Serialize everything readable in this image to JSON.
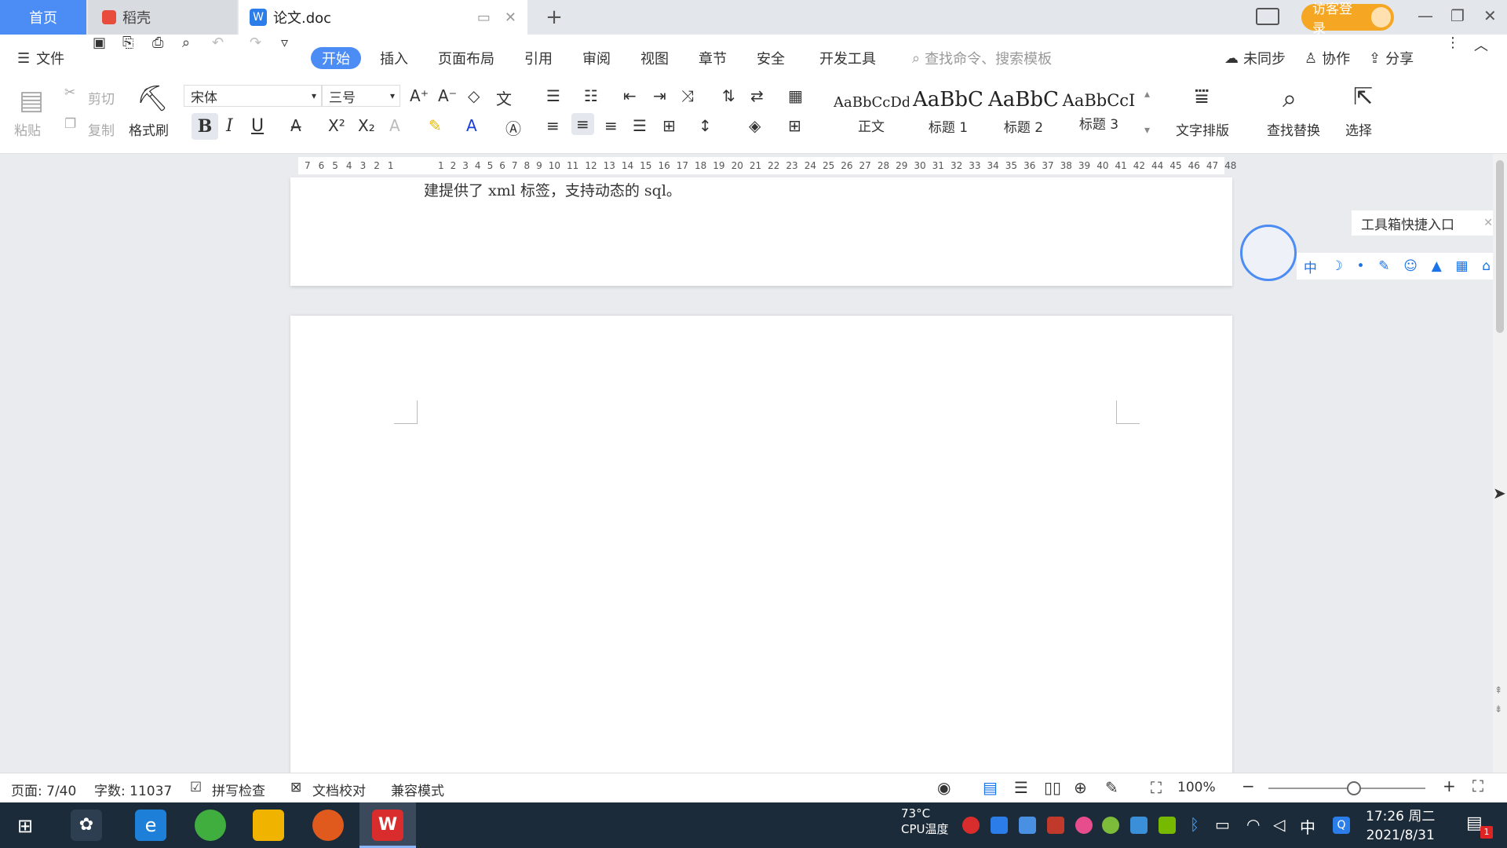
{
  "titlebar": {
    "tabs": [
      {
        "label": "首页"
      },
      {
        "label": "稻壳"
      },
      {
        "label": "论文.doc"
      }
    ],
    "add_tab": "+",
    "login": "访客登录"
  },
  "menubar": {
    "file": "文件",
    "items": [
      "开始",
      "插入",
      "页面布局",
      "引用",
      "审阅",
      "视图",
      "章节",
      "安全",
      "开发工具"
    ],
    "search_placeholder": "查找命令、搜索模板",
    "sync": "未同步",
    "collab": "协作",
    "share": "分享"
  },
  "toolbar": {
    "paste": "粘贴",
    "cut": "剪切",
    "copy": "复制",
    "format_painter": "格式刷",
    "font_name": "宋体",
    "font_size": "三号",
    "bold": "B",
    "italic": "I",
    "underline": "U",
    "styles": [
      {
        "sample": "AaBbCcDd",
        "label": "正文"
      },
      {
        "sample": "AaBbC",
        "label": "标题 1"
      },
      {
        "sample": "AaBbC",
        "label": "标题 2"
      },
      {
        "sample": "AaBbCcI",
        "label": "标题 3"
      }
    ],
    "text_layout": "文字排版",
    "find_replace": "查找替换",
    "select": "选择"
  },
  "ruler": {
    "left_numbers": [
      "7",
      "6",
      "5",
      "4",
      "3",
      "2",
      "1"
    ],
    "right_numbers": [
      "1",
      "2",
      "3",
      "4",
      "5",
      "6",
      "7",
      "8",
      "9",
      "10",
      "11",
      "12",
      "13",
      "14",
      "15",
      "16",
      "17",
      "18",
      "19",
      "20",
      "21",
      "22",
      "23",
      "24",
      "25",
      "26",
      "27",
      "28",
      "29",
      "30",
      "31",
      "32",
      "33",
      "34",
      "35",
      "36",
      "37",
      "38",
      "39",
      "40",
      "41",
      "42",
      "44",
      "45",
      "46",
      "47",
      "48"
    ]
  },
  "document": {
    "visible_line": "建提供了 xml 标签，支持动态的 sql。"
  },
  "toolbox": {
    "label": "工具箱快捷入口",
    "icons": [
      "中",
      "☽",
      "•",
      "✎",
      "☺",
      "▲",
      "▦",
      "⌂"
    ]
  },
  "statusbar": {
    "page": "页面: 7/40",
    "words": "字数: 11037",
    "spell": "拼写检查",
    "proof": "文档校对",
    "compat": "兼容模式",
    "zoom": "100%"
  },
  "taskbar": {
    "temp": "73°C",
    "cpu": "CPU温度",
    "ime": "中",
    "time": "17:26 周二",
    "date": "2021/8/31",
    "notif_count": "1"
  },
  "colors": {
    "accent": "#4b8cf5",
    "login": "#f5a623",
    "taskbar": "#1c2b3a"
  }
}
